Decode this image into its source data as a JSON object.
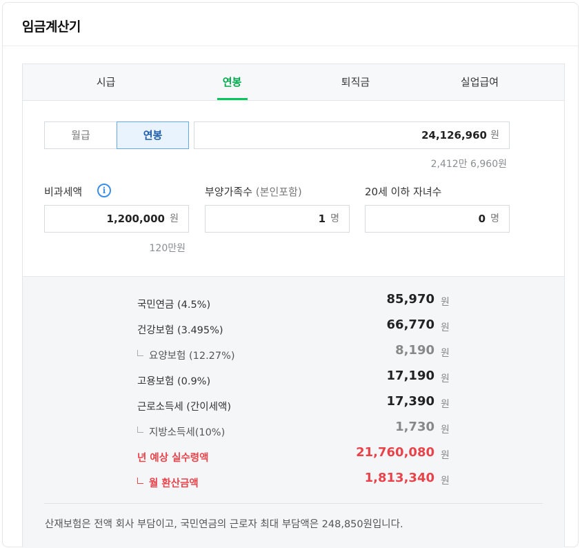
{
  "title": "임금계산기",
  "tabs": [
    {
      "label": "시급",
      "active": false
    },
    {
      "label": "연봉",
      "active": true
    },
    {
      "label": "퇴직금",
      "active": false
    },
    {
      "label": "실업급여",
      "active": false
    }
  ],
  "pay_type": {
    "monthly_label": "월급",
    "annual_label": "연봉",
    "selected": "연봉"
  },
  "salary": {
    "value": "24,126,960",
    "unit": "원",
    "hint": "2,412만 6,960원"
  },
  "nontax": {
    "label": "비과세액",
    "info_icon": "info-icon",
    "value": "1,200,000",
    "unit": "원",
    "hint": "120만원"
  },
  "dependents": {
    "label": "부양가족수",
    "label_sub": "(본인포함)",
    "value": "1",
    "unit": "명"
  },
  "children": {
    "label": "20세 이하 자녀수",
    "value": "0",
    "unit": "명"
  },
  "results": {
    "national_pension": {
      "label": "국민연금 (4.5%)",
      "value": "85,970",
      "unit": "원"
    },
    "health_insurance": {
      "label": "건강보험 (3.495%)",
      "value": "66,770",
      "unit": "원"
    },
    "long_term_care": {
      "label": "요양보험 (12.27%)",
      "value": "8,190",
      "unit": "원"
    },
    "employment_insurance": {
      "label": "고용보험 (0.9%)",
      "value": "17,190",
      "unit": "원"
    },
    "income_tax": {
      "label": "근로소득세 (간이세액)",
      "value": "17,390",
      "unit": "원"
    },
    "local_income_tax": {
      "label": "지방소득세(10%)",
      "value": "1,730",
      "unit": "원"
    },
    "annual_net": {
      "label": "년 예상 실수령액",
      "value": "21,760,080",
      "unit": "원"
    },
    "monthly_net": {
      "label": "월 환산금액",
      "value": "1,813,340",
      "unit": "원"
    }
  },
  "note": "산재보험은 전액 회사 부담이고, 국민연금의 근로자 최대 부담액은 248,850원입니다.",
  "colors": {
    "accent_green": "#03c75a",
    "highlight_red": "#e8434a",
    "toggle_blue": "#1c5cab",
    "info_blue": "#3a8ee6"
  }
}
